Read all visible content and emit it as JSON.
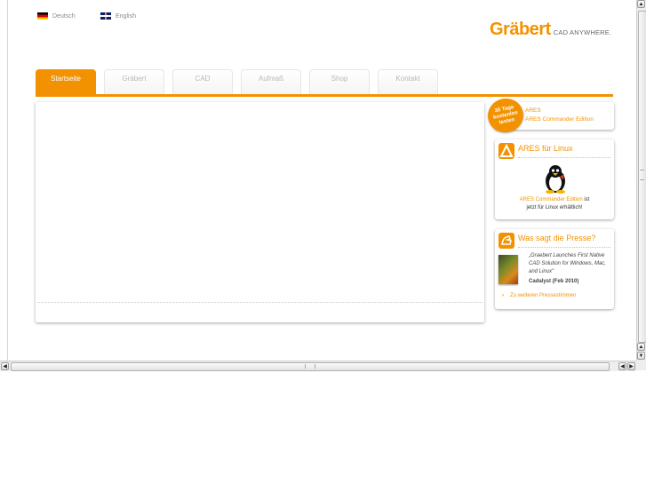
{
  "languages": [
    {
      "label": "Deutsch",
      "flag": "germany-flag-icon"
    },
    {
      "label": "English",
      "flag": "uk-flag-icon"
    }
  ],
  "logo": {
    "brand": "Gräbert",
    "tagline": "CAD ANYWHERE."
  },
  "nav": {
    "tabs": [
      "Startseite",
      "Gräbert",
      "CAD",
      "Aufmaß",
      "Shop",
      "Kontakt"
    ],
    "active": "Startseite"
  },
  "promo": {
    "badge_line1": "30 Tage",
    "badge_line2": "kostenlos",
    "badge_line3": "testen",
    "link1": "ARES",
    "link2": "ARES Commander Edition"
  },
  "linux_box": {
    "title": "ARES für Linux",
    "text_highlight": "ARES Commander Edition",
    "text_after": " ist",
    "text_line2": "jetzt für Linux erhältlich!"
  },
  "press_box": {
    "title": "Was sagt die Presse?",
    "quote": "„Graebert Launches First Native CAD Solution for Windows, Mac, and Linux\"",
    "source": "Cadalyst (Feb 2010)",
    "more_link": "Zu weiteren Pressestimmen"
  },
  "colors": {
    "accent": "#f39200",
    "tab_text": "#b8b8b8"
  }
}
